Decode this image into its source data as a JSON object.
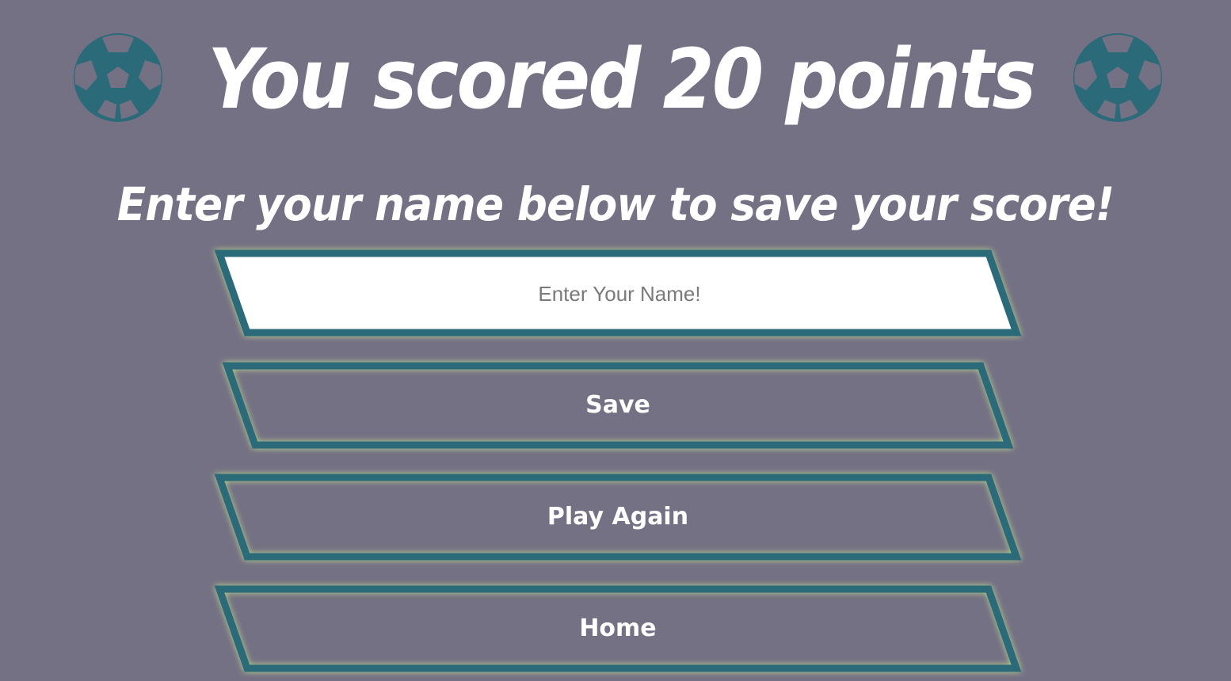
{
  "header": {
    "title": "You scored 20 points",
    "subtitle": "Enter your name below to save your score!",
    "icon_left": "soccer-ball-icon",
    "icon_right": "soccer-ball-icon"
  },
  "form": {
    "name_placeholder": "Enter Your Name!",
    "name_value": ""
  },
  "buttons": {
    "save_label": "Save",
    "play_again_label": "Play Again",
    "home_label": "Home"
  },
  "colors": {
    "background": "#757185",
    "border": "#2b6a78",
    "glow": "#b7d98a",
    "text": "#ffffff",
    "input_fill": "#ffffff"
  }
}
